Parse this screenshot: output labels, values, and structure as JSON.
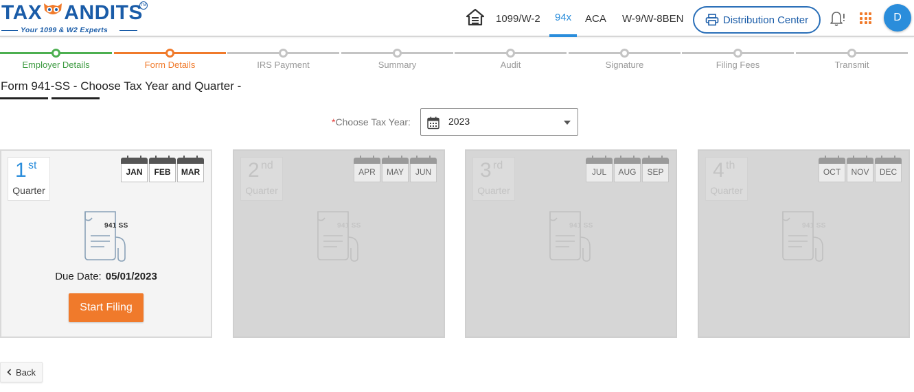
{
  "header": {
    "logo": {
      "text_left": "TAX",
      "text_right": "ANDITS",
      "trademark": "TM",
      "tagline": "Your 1099 & W2 Experts"
    },
    "nav": [
      {
        "label": "1099/W-2",
        "active": false
      },
      {
        "label": "94x",
        "active": true
      },
      {
        "label": "ACA",
        "active": false
      },
      {
        "label": "W-9/W-8BEN",
        "active": false
      }
    ],
    "distribution_center_label": "Distribution Center",
    "avatar_initial": "D"
  },
  "steps": [
    {
      "label": "Employer Details",
      "status": "done"
    },
    {
      "label": "Form Details",
      "status": "current"
    },
    {
      "label": "IRS Payment",
      "status": "pending"
    },
    {
      "label": "Summary",
      "status": "pending"
    },
    {
      "label": "Audit",
      "status": "pending"
    },
    {
      "label": "Signature",
      "status": "pending"
    },
    {
      "label": "Filing Fees",
      "status": "pending"
    },
    {
      "label": "Transmit",
      "status": "pending"
    }
  ],
  "page": {
    "title": "Form 941-SS - Choose Tax Year and Quarter -",
    "tax_year_label": "Choose Tax Year:",
    "tax_year_required_mark": "*",
    "tax_year_value": "2023"
  },
  "quarters": [
    {
      "number": "1",
      "suffix": "st",
      "word": "Quarter",
      "months": [
        "JAN",
        "FEB",
        "MAR"
      ],
      "form_code": "941 SS",
      "enabled": true,
      "due_label": "Due Date:",
      "due_date": "05/01/2023",
      "action_label": "Start Filing"
    },
    {
      "number": "2",
      "suffix": "nd",
      "word": "Quarter",
      "months": [
        "APR",
        "MAY",
        "JUN"
      ],
      "form_code": "941 SS",
      "enabled": false
    },
    {
      "number": "3",
      "suffix": "rd",
      "word": "Quarter",
      "months": [
        "JUL",
        "AUG",
        "SEP"
      ],
      "form_code": "941 SS",
      "enabled": false
    },
    {
      "number": "4",
      "suffix": "th",
      "word": "Quarter",
      "months": [
        "OCT",
        "NOV",
        "DEC"
      ],
      "form_code": "941 SS",
      "enabled": false
    }
  ],
  "footer": {
    "back_label": "Back"
  },
  "colors": {
    "brand_blue": "#1a5ca8",
    "accent_blue": "#2a8ddb",
    "orange": "#f07a2b",
    "green": "#4caf50"
  },
  "icons": [
    "home-icon",
    "printer-icon",
    "bell-icon",
    "apps-grid-icon",
    "calendar-icon",
    "chevron-down-icon",
    "form-document-icon",
    "chevron-left-icon"
  ]
}
